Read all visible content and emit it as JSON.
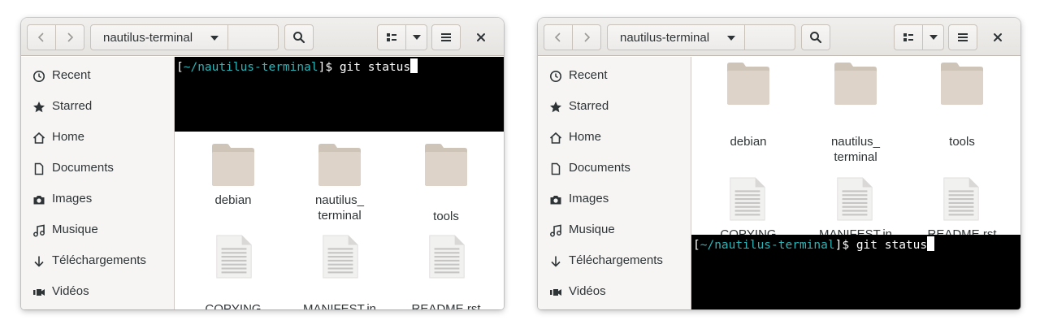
{
  "colors": {
    "headerbar": "#e8e6e3",
    "sidebar_bg": "#f6f5f4",
    "terminal_bg": "#000000",
    "terminal_fg": "#ffffff",
    "terminal_path": "#2cb5b8",
    "folder": "#ddd3c9",
    "text": "#2e3436"
  },
  "windows": [
    {
      "path_label": "nautilus-terminal",
      "terminal": {
        "open_bracket": "[",
        "cwd": "~/nautilus-terminal",
        "prompt_suffix": "]$ ",
        "command": "git status"
      },
      "icons": {
        "back": "go-back-icon",
        "forward": "go-forward-icon",
        "dropdown": "pan-down-icon",
        "search": "search-icon",
        "view": "list-view-icon",
        "menu": "hamburger-menu-icon",
        "close": "close-icon"
      },
      "sidebar": [
        {
          "label": "Recent",
          "icon": "clock-icon"
        },
        {
          "label": "Starred",
          "icon": "star-icon"
        },
        {
          "label": "Home",
          "icon": "home-icon"
        },
        {
          "label": "Documents",
          "icon": "document-icon"
        },
        {
          "label": "Images",
          "icon": "camera-icon"
        },
        {
          "label": "Musique",
          "icon": "music-icon"
        },
        {
          "label": "Téléchargements",
          "icon": "download-icon"
        },
        {
          "label": "Vidéos",
          "icon": "video-icon"
        }
      ],
      "files": [
        {
          "line1": "debian",
          "line2": "",
          "icon": "folder-icon"
        },
        {
          "line1": "nautilus_",
          "line2": "terminal",
          "icon": "folder-icon"
        },
        {
          "line1": "tools",
          "line2": "",
          "icon": "folder-icon"
        },
        {
          "line1": "COPYING",
          "line2": "",
          "icon": "text-file-icon"
        },
        {
          "line1": "MANIFEST.in",
          "line2": "",
          "icon": "text-file-icon"
        },
        {
          "line1": "README.rst",
          "line2": "",
          "icon": "text-file-icon"
        }
      ]
    },
    {
      "path_label": "nautilus-terminal",
      "terminal": {
        "open_bracket": "[",
        "cwd": "~/nautilus-terminal",
        "prompt_suffix": "]$ ",
        "command": "git status"
      },
      "icons": {
        "back": "go-back-icon",
        "forward": "go-forward-icon",
        "dropdown": "pan-down-icon",
        "search": "search-icon",
        "view": "list-view-icon",
        "menu": "hamburger-menu-icon",
        "close": "close-icon"
      },
      "sidebar": [
        {
          "label": "Recent",
          "icon": "clock-icon"
        },
        {
          "label": "Starred",
          "icon": "star-icon"
        },
        {
          "label": "Home",
          "icon": "home-icon"
        },
        {
          "label": "Documents",
          "icon": "document-icon"
        },
        {
          "label": "Images",
          "icon": "camera-icon"
        },
        {
          "label": "Musique",
          "icon": "music-icon"
        },
        {
          "label": "Téléchargements",
          "icon": "download-icon"
        },
        {
          "label": "Vidéos",
          "icon": "video-icon"
        }
      ],
      "files": [
        {
          "line1": "debian",
          "line2": "",
          "icon": "folder-icon"
        },
        {
          "line1": "nautilus_",
          "line2": "terminal",
          "icon": "folder-icon"
        },
        {
          "line1": "tools",
          "line2": "",
          "icon": "folder-icon"
        },
        {
          "line1": "COPYING",
          "line2": "",
          "icon": "text-file-icon"
        },
        {
          "line1": "MANIFEST.in",
          "line2": "",
          "icon": "text-file-icon"
        },
        {
          "line1": "README.rst",
          "line2": "",
          "icon": "text-file-icon"
        }
      ]
    }
  ]
}
